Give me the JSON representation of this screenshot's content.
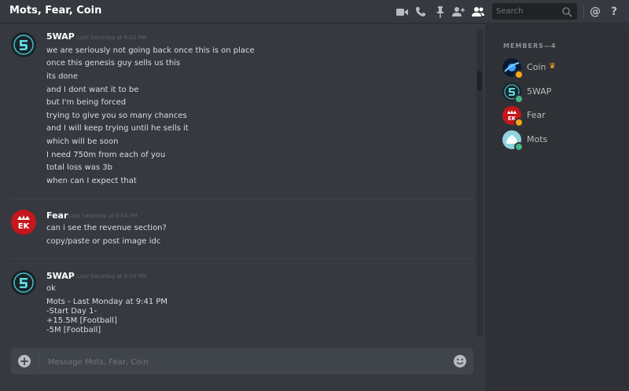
{
  "header": {
    "title": "Mots, Fear, Coin",
    "search_placeholder": "Search",
    "icons": [
      "video-camera-icon",
      "phone-icon",
      "pin-icon",
      "add-member-icon",
      "members-list-icon",
      "search-icon",
      "mention-icon",
      "help-icon"
    ]
  },
  "messages": [
    {
      "author": "5WAP",
      "timestamp": "Last Saturday at 6:02 PM",
      "lines": [
        "we are seriously not going back once this is on place",
        "once this genesis guy sells us this",
        "its done",
        "and I dont want it to be",
        "but I'm being forced",
        "trying to give you so many chances",
        "and I will keep trying until he sells it",
        "which will be soon",
        "I need 750m from each of you",
        "total loss was 3b",
        "when can I expect that"
      ]
    },
    {
      "author": "Fear",
      "timestamp": "Last Saturday at 6:54 PM",
      "lines": [
        "can i see the revenue section?",
        "copy/paste or post image idc"
      ]
    },
    {
      "author": "5WAP",
      "timestamp": "Last Saturday at 6:54 PM",
      "lines": [
        "ok",
        "Mots - Last Monday at 9:41 PM",
        "-Start Day 1-",
        "+15.5M [Football]",
        "-5M [Football]"
      ]
    }
  ],
  "composer": {
    "placeholder": "Message Mots, Fear, Coin"
  },
  "members": {
    "header": "MEMBERS—4",
    "list": [
      {
        "name": "Coin",
        "status": "idle",
        "status_color": "#faa61a",
        "owner": true
      },
      {
        "name": "5WAP",
        "status": "online",
        "status_color": "#43b581",
        "owner": false
      },
      {
        "name": "Fear",
        "status": "idle",
        "status_color": "#faa61a",
        "owner": false
      },
      {
        "name": "Mots",
        "status": "online",
        "status_color": "#43b581",
        "owner": false
      }
    ]
  },
  "colors": {
    "background": "#36393f",
    "sidebar": "#2f3136",
    "composer": "#40444b",
    "online": "#43b581",
    "idle": "#faa61a"
  }
}
